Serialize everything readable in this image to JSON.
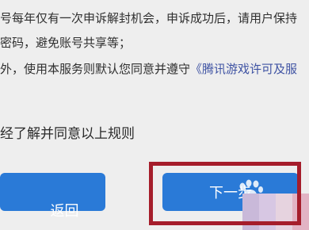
{
  "rules": {
    "line1": "号每年仅有一次申诉解封机会，申诉成功后，请用户保持",
    "line2": "密码，避免账号共享等；",
    "line3_prefix": "外，使用本服务则默认您同意并遵守",
    "line3_link": "《腾讯游戏许可及服"
  },
  "agree_text": "经了解并同意以上规则",
  "buttons": {
    "back_label": "返回",
    "next_label": "下一步"
  },
  "colors": {
    "button_blue": "#2a7ad7",
    "highlight_red": "#a51d2b",
    "link_blue": "#3f53a3"
  }
}
